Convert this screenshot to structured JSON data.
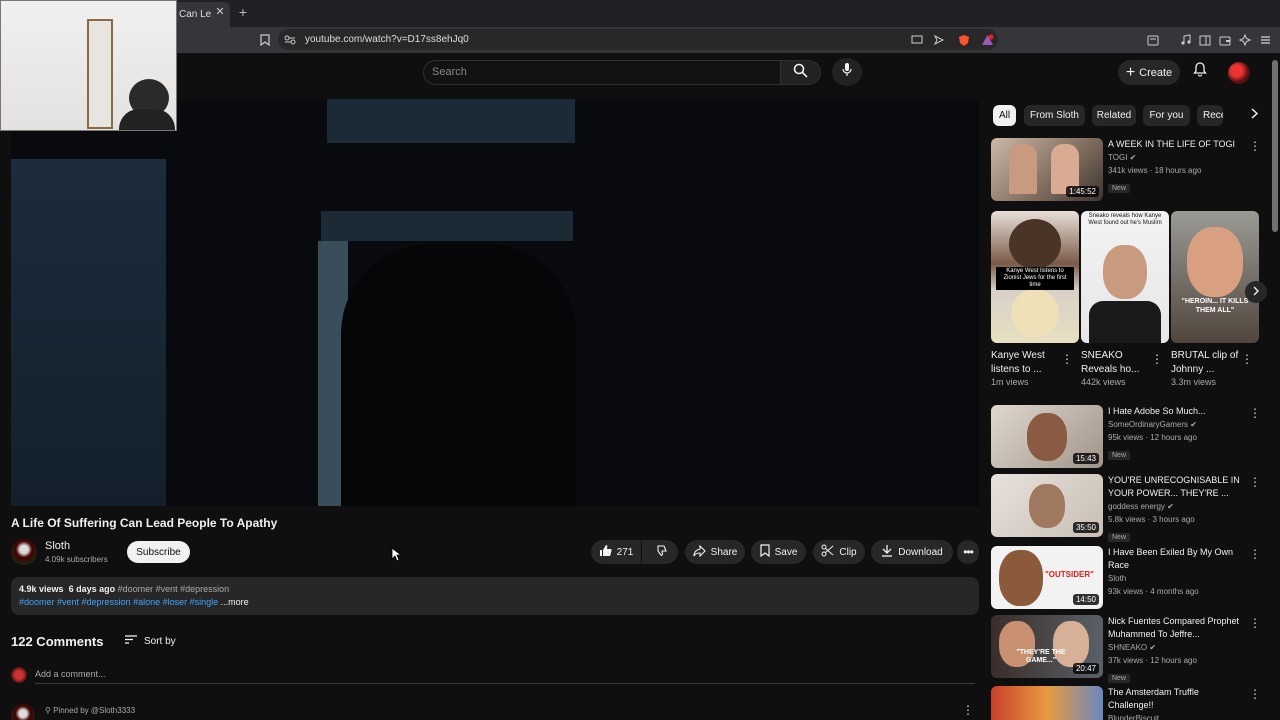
{
  "browser": {
    "tab_title": "Can Le",
    "tab_close": "✕",
    "new_tab": "+",
    "url": "youtube.com/watch?v=D17ss8ehJq0"
  },
  "header": {
    "search_placeholder": "Search",
    "create_label": "Create"
  },
  "video": {
    "title": "A Life Of Suffering Can Lead People To Apathy",
    "channel": "Sloth",
    "subscribers": "4.09k subscribers",
    "subscribe_label": "Subscribe",
    "likes": "271",
    "share_label": "Share",
    "save_label": "Save",
    "clip_label": "Clip",
    "download_label": "Download"
  },
  "description": {
    "views": "4.9k views",
    "date": "6 days ago",
    "tags_line1": "#doomer #vent #depression",
    "tags_line2": "#doomer #vent #depression #alone #loser #single",
    "more": "...more"
  },
  "comments": {
    "count_label": "122 Comments",
    "sort_label": "Sort by",
    "add_placeholder": "Add a comment...",
    "pinned_label": "Pinned by @Sloth3333"
  },
  "chips": [
    "All",
    "From Sloth",
    "Related",
    "For you",
    "Rece"
  ],
  "recommended_top": {
    "title": "A WEEK IN THE LIFE OF TOGI",
    "channel": "TOGI",
    "meta": "341k views · 18 hours ago",
    "badge": "New",
    "duration": "1:45:52"
  },
  "shorts": [
    {
      "title": "Kanye West listens to ...",
      "views": "1m views"
    },
    {
      "title": "SNEAKO Reveals ho...",
      "views": "442k views"
    },
    {
      "title": "BRUTAL clip of Johnny ...",
      "views": "3.3m views"
    }
  ],
  "shorts_overlay": {
    "s1": "Kanye West listens to Zionist Jews for the first time",
    "s2": "Sneako reveals how Kanye West found out he's Muslim",
    "s3": "\"HEROIN... IT KILLS THEM ALL\""
  },
  "recommended": [
    {
      "title": "I Hate Adobe So Much...",
      "channel": "SomeOrdinaryGamers",
      "meta": "95k views · 12 hours ago",
      "badge": "New",
      "duration": "15:43",
      "verified": true
    },
    {
      "title": "YOU'RE UNRECOGNISABLE IN YOUR POWER... THEY'RE ...",
      "channel": "goddess energy",
      "meta": "5.8k views · 3 hours ago",
      "badge": "New",
      "duration": "35:50",
      "verified": true
    },
    {
      "title": "I Have Been Exiled By My Own Race",
      "channel": "Sloth",
      "meta": "93k views · 4 months ago",
      "badge": "",
      "duration": "14:50",
      "verified": false
    },
    {
      "title": "Nick Fuentes Compared Prophet Muhammed To Jeffre...",
      "channel": "SHNEAKO",
      "meta": "37k views · 12 hours ago",
      "badge": "New",
      "duration": "20:47",
      "verified": true
    },
    {
      "title": "The Amsterdam Truffle Challenge!!",
      "channel": "BlunderBiscuit",
      "meta": "",
      "badge": "",
      "duration": "",
      "verified": false
    }
  ],
  "thumb_text": {
    "outsider": "\"OUTSIDER\"",
    "game": "\"THEY'RE THE GAME...\""
  },
  "colors": {
    "bg": "#0f0f0f",
    "surface": "#272727",
    "link": "#3ea6ff",
    "text": "#f1f1f1",
    "muted": "#aaaaaa"
  }
}
